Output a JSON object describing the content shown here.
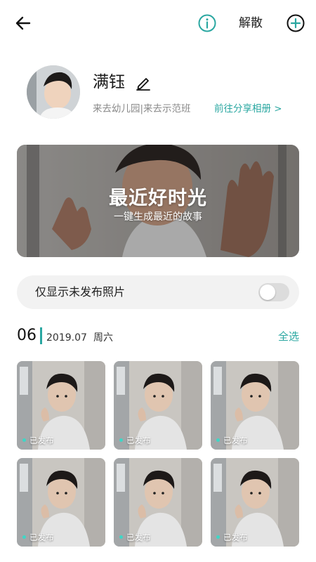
{
  "header": {
    "back_icon": "arrow-left-icon",
    "info_icon": "info-circle-icon",
    "dismiss_label": "解散",
    "add_icon": "plus-circle-icon",
    "accent_color": "#2aa7a1"
  },
  "profile": {
    "name": "满钰",
    "edit_icon": "pencil-icon",
    "description": "来去幼儿园|来去示范班",
    "share_link": "前往分享相册 >"
  },
  "banner": {
    "title": "最近好时光",
    "subtitle": "一键生成最近的故事"
  },
  "filter": {
    "label": "仅显示未发布照片",
    "toggle_on": false
  },
  "date_group": {
    "day": "06",
    "month": "2019.07",
    "weekday": "周六",
    "select_all": "全选"
  },
  "photos": [
    {
      "status": "已发布"
    },
    {
      "status": "已发布"
    },
    {
      "status": "已发布"
    },
    {
      "status": "已发布"
    },
    {
      "status": "已发布"
    },
    {
      "status": "已发布"
    }
  ]
}
